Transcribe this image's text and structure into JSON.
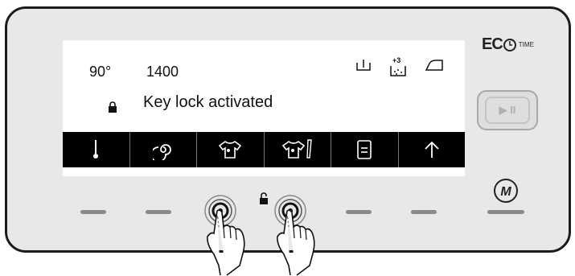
{
  "display": {
    "temperature": "90°",
    "spin_speed": "1400",
    "message": "Key lock activated",
    "status_icons": [
      "prewash-icon",
      "extra-rinse-icon",
      "iron-icon"
    ],
    "extra_rinse_label": "+3"
  },
  "option_bar": {
    "items": [
      "thermometer-icon",
      "spin-icon",
      "shirt-icon",
      "shirt-stain-icon",
      "document-icon",
      "arrow-up-icon"
    ]
  },
  "brand": {
    "eco_label": "EC",
    "time_label": "TIME"
  },
  "controls": {
    "playpause_label": "▶ II",
    "m_label": "M"
  },
  "colors": {
    "display_bar": "#000000",
    "panel": "#e8e8e8",
    "border": "#1c1c1c"
  }
}
